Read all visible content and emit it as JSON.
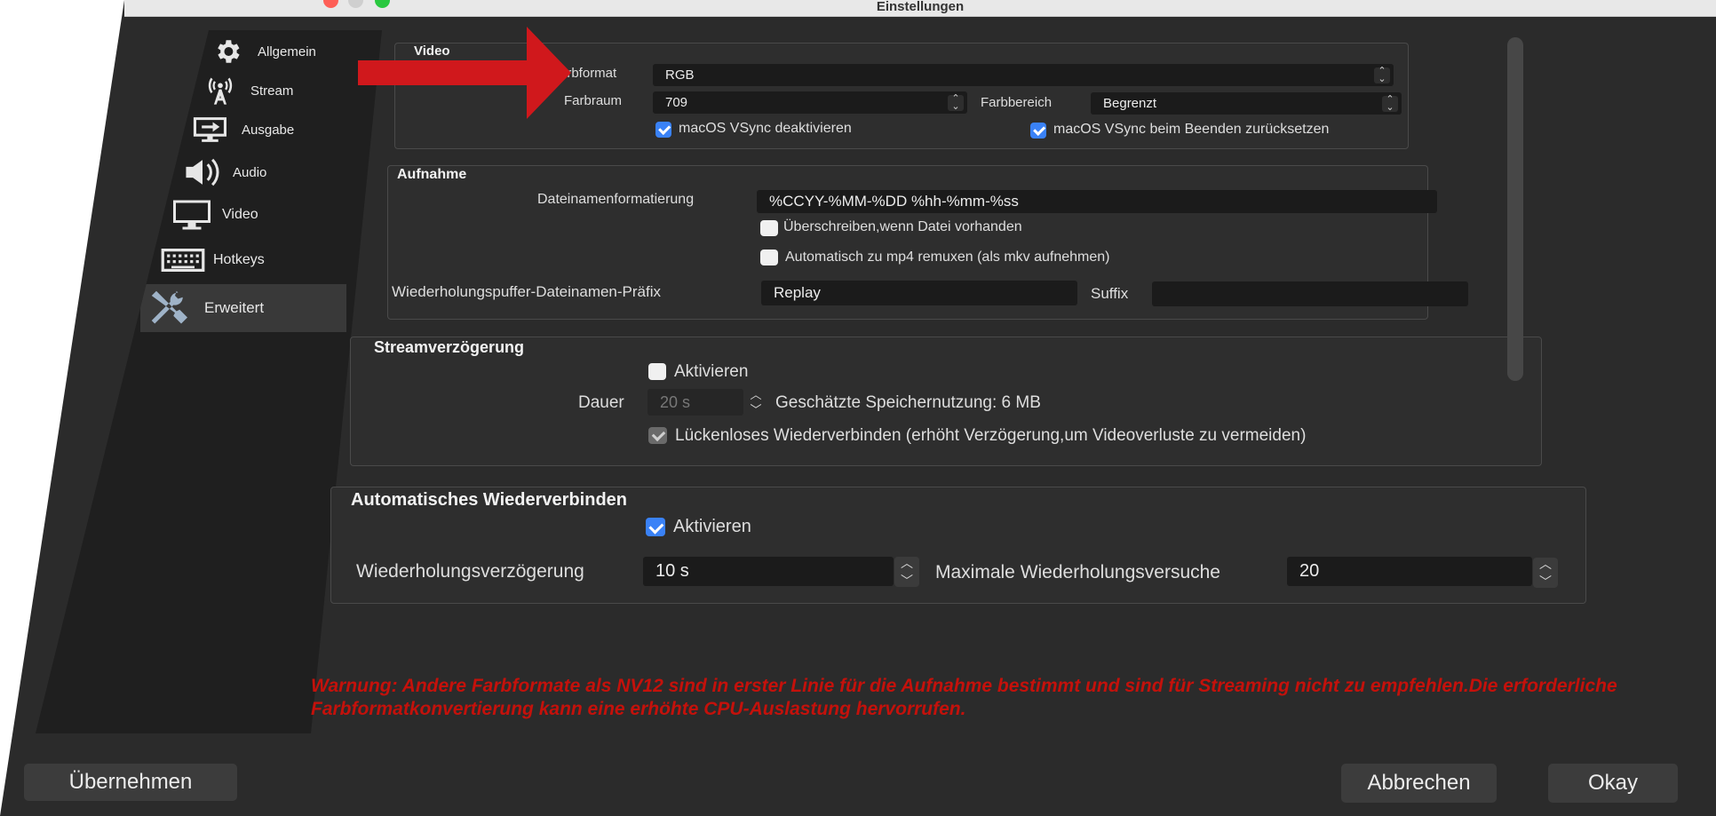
{
  "window": {
    "title": "Einstellungen"
  },
  "sidebar": {
    "items": [
      {
        "label": "Allgemein",
        "icon": "gear-icon"
      },
      {
        "label": "Stream",
        "icon": "broadcast-antenna-icon"
      },
      {
        "label": "Ausgabe",
        "icon": "output-icon"
      },
      {
        "label": "Audio",
        "icon": "speaker-icon"
      },
      {
        "label": "Video",
        "icon": "monitor-icon"
      },
      {
        "label": "Hotkeys",
        "icon": "keyboard-icon"
      },
      {
        "label": "Erweitert",
        "icon": "tools-icon",
        "active": true
      }
    ]
  },
  "video": {
    "title": "Video",
    "farbformat_label": "arbformat",
    "farbformat_value": "RGB",
    "farbraum_label": "Farbraum",
    "farbraum_value": "709",
    "farbbereich_label": "Farbbereich",
    "farbbereich_value": "Begrenzt",
    "vsync_disable_label": "macOS VSync deaktivieren",
    "vsync_disable_checked": true,
    "vsync_reset_label": "macOS VSync beim Beenden zurücksetzen",
    "vsync_reset_checked": true
  },
  "aufnahme": {
    "title": "Aufnahme",
    "filename_format_label": "Dateinamenformatierung",
    "filename_format_value": "%CCYY-%MM-%DD %hh-%mm-%ss",
    "overwrite_label": "Überschreiben,wenn Datei vorhanden",
    "overwrite_checked": false,
    "remux_label": "Automatisch zu mp4 remuxen (als mkv aufnehmen)",
    "remux_checked": false,
    "replay_prefix_label": "Wiederholungspuffer-Dateinamen-Präfix",
    "replay_prefix_value": "Replay",
    "suffix_label": "Suffix",
    "suffix_value": ""
  },
  "streamdelay": {
    "title": "Streamverzögerung",
    "enable_label": "Aktivieren",
    "enable_checked": false,
    "duration_label": "Dauer",
    "duration_value": "20 s",
    "memory_estimate": "Geschätzte Speichernutzung: 6 MB",
    "reconnect_label": "Lückenloses Wiederverbinden (erhöht Verzögerung,um Videoverluste zu vermeiden)",
    "reconnect_checked": true
  },
  "autoreconnect": {
    "title": "Automatisches Wiederverbinden",
    "enable_label": "Aktivieren",
    "enable_checked": true,
    "retry_delay_label": "Wiederholungsverzögerung",
    "retry_delay_value": "10 s",
    "max_retries_label": "Maximale Wiederholungsversuche",
    "max_retries_value": "20"
  },
  "warning": {
    "text": "Warnung: Andere Farbformate als NV12 sind in erster Linie für die Aufnahme bestimmt und sind für Streaming nicht zu empfehlen.Die erforderliche Farbformatkonvertierung kann eine erhöhte CPU-Auslastung hervorrufen.",
    "color": "#c4110b"
  },
  "buttons": {
    "apply": "Übernehmen",
    "cancel": "Abbrechen",
    "ok": "Okay"
  },
  "colors": {
    "accent": "#3a82f7",
    "arrow": "#d0181c"
  }
}
